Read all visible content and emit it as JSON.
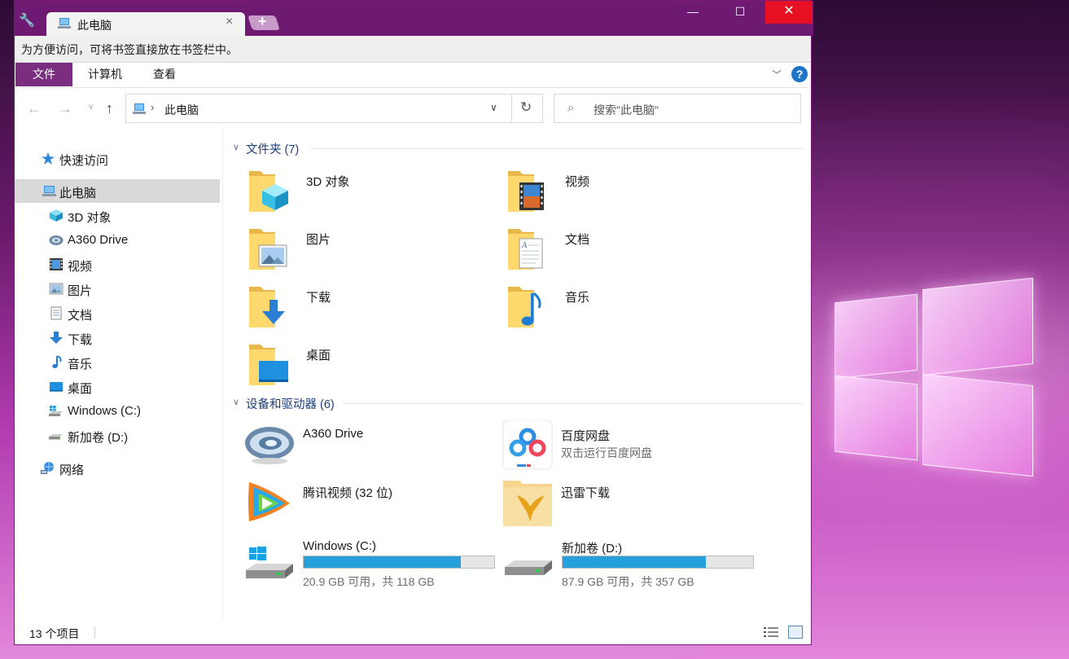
{
  "window": {
    "tab_title": "此电脑"
  },
  "caption": {
    "minimize": "—",
    "maximize": "☐",
    "close": "✕"
  },
  "infobar": {
    "text": "为方便访问，可将书签直接放在书签栏中。"
  },
  "ribbon": {
    "tabs": [
      "文件",
      "计算机",
      "查看"
    ],
    "help": "?"
  },
  "address": {
    "path": "此电脑"
  },
  "search": {
    "placeholder": "搜索\"此电脑\""
  },
  "sidebar": {
    "items": [
      {
        "label": "快速访问",
        "icon": "star-icon"
      },
      {
        "label": "此电脑",
        "icon": "computer-icon",
        "selected": true
      },
      {
        "label": "3D 对象",
        "icon": "cube-icon"
      },
      {
        "label": "A360 Drive",
        "icon": "a360-icon"
      },
      {
        "label": "视频",
        "icon": "film-icon"
      },
      {
        "label": "图片",
        "icon": "picture-icon"
      },
      {
        "label": "文档",
        "icon": "document-icon"
      },
      {
        "label": "下载",
        "icon": "download-arrow-icon"
      },
      {
        "label": "音乐",
        "icon": "music-note-icon"
      },
      {
        "label": "桌面",
        "icon": "desktop-icon"
      },
      {
        "label": "Windows (C:)",
        "icon": "windows-drive-icon"
      },
      {
        "label": "新加卷 (D:)",
        "icon": "drive-icon"
      },
      {
        "label": "网络",
        "icon": "network-icon"
      }
    ]
  },
  "folders_group": {
    "title": "文件夹 (7)",
    "items": [
      {
        "name": "3D 对象",
        "icon": "folder-3d-objects-icon"
      },
      {
        "name": "视频",
        "icon": "folder-videos-icon"
      },
      {
        "name": "图片",
        "icon": "folder-pictures-icon"
      },
      {
        "name": "文档",
        "icon": "folder-documents-icon"
      },
      {
        "name": "下载",
        "icon": "folder-downloads-icon"
      },
      {
        "name": "音乐",
        "icon": "folder-music-icon"
      },
      {
        "name": "桌面",
        "icon": "folder-desktop-icon"
      }
    ]
  },
  "devices_group": {
    "title": "设备和驱动器 (6)",
    "items": [
      {
        "name": "A360 Drive",
        "sub": "",
        "icon": "a360-drive-icon"
      },
      {
        "name": "百度网盘",
        "sub": "双击运行百度网盘",
        "icon": "baidu-netdisk-icon"
      },
      {
        "name": "腾讯视频 (32 位)",
        "sub": "",
        "icon": "tencent-video-icon"
      },
      {
        "name": "迅雷下载",
        "sub": "",
        "icon": "xunlei-icon"
      }
    ],
    "drives": [
      {
        "name": "Windows (C:)",
        "space": "20.9 GB 可用，共 118 GB",
        "used_fraction": 0.823,
        "icon": "windows-drive-icon"
      },
      {
        "name": "新加卷 (D:)",
        "space": "87.9 GB 可用，共 357 GB",
        "used_fraction": 0.754,
        "icon": "drive-icon"
      }
    ]
  },
  "status": {
    "count": "13 个项目"
  },
  "colors": {
    "accent": "#7b2d7f",
    "titlebar": "#6e1a72",
    "close": "#e81123",
    "drive_fill": "#26a0da",
    "group_title": "#1e3f7a"
  }
}
